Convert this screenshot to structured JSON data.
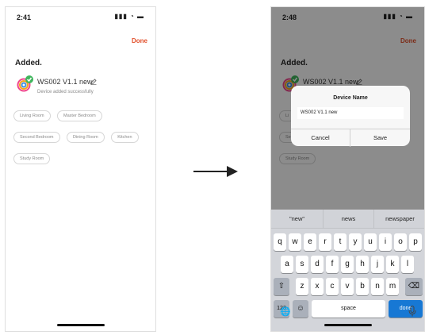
{
  "left_screen": {
    "time": "2:41",
    "status_icons": "▮▮▮ ◔ ▬",
    "done_label": "Done",
    "added_heading": "Added.",
    "device_name": "WS002 V1.1 new",
    "device_status": "Device added successfully",
    "rooms": [
      "Living Room",
      "Master Bedroom",
      "Second Bedroom",
      "Dining Room",
      "Kitchen",
      "Study Room"
    ]
  },
  "right_screen": {
    "time": "2:48",
    "status_icons": "▮▮▮ ◔ ▬",
    "done_label": "Done",
    "added_heading": "Added.",
    "device_name": "WS002 V1.1 new",
    "room_stubs": [
      "Li",
      "Se",
      "Study Room"
    ],
    "dialog": {
      "title": "Device Name",
      "input_value": "WS002 V1.1 new",
      "cancel_label": "Cancel",
      "save_label": "Save"
    },
    "keyboard": {
      "predictions": [
        "\"new\"",
        "news",
        "newspaper"
      ],
      "row1": [
        "q",
        "w",
        "e",
        "r",
        "t",
        "y",
        "u",
        "i",
        "o",
        "p"
      ],
      "row2": [
        "a",
        "s",
        "d",
        "f",
        "g",
        "h",
        "j",
        "k",
        "l"
      ],
      "row3": [
        "z",
        "x",
        "c",
        "v",
        "b",
        "n",
        "m"
      ],
      "shift_symbol": "⇧",
      "backspace_symbol": "⌫",
      "numbers_label": "123",
      "emoji_symbol": "☺",
      "space_label": "space",
      "done_label": "done",
      "globe_symbol": "🌐"
    }
  },
  "colors": {
    "accent": "#e2502c",
    "done_key": "#1778d4",
    "keyboard_bg": "#d3d5da"
  }
}
